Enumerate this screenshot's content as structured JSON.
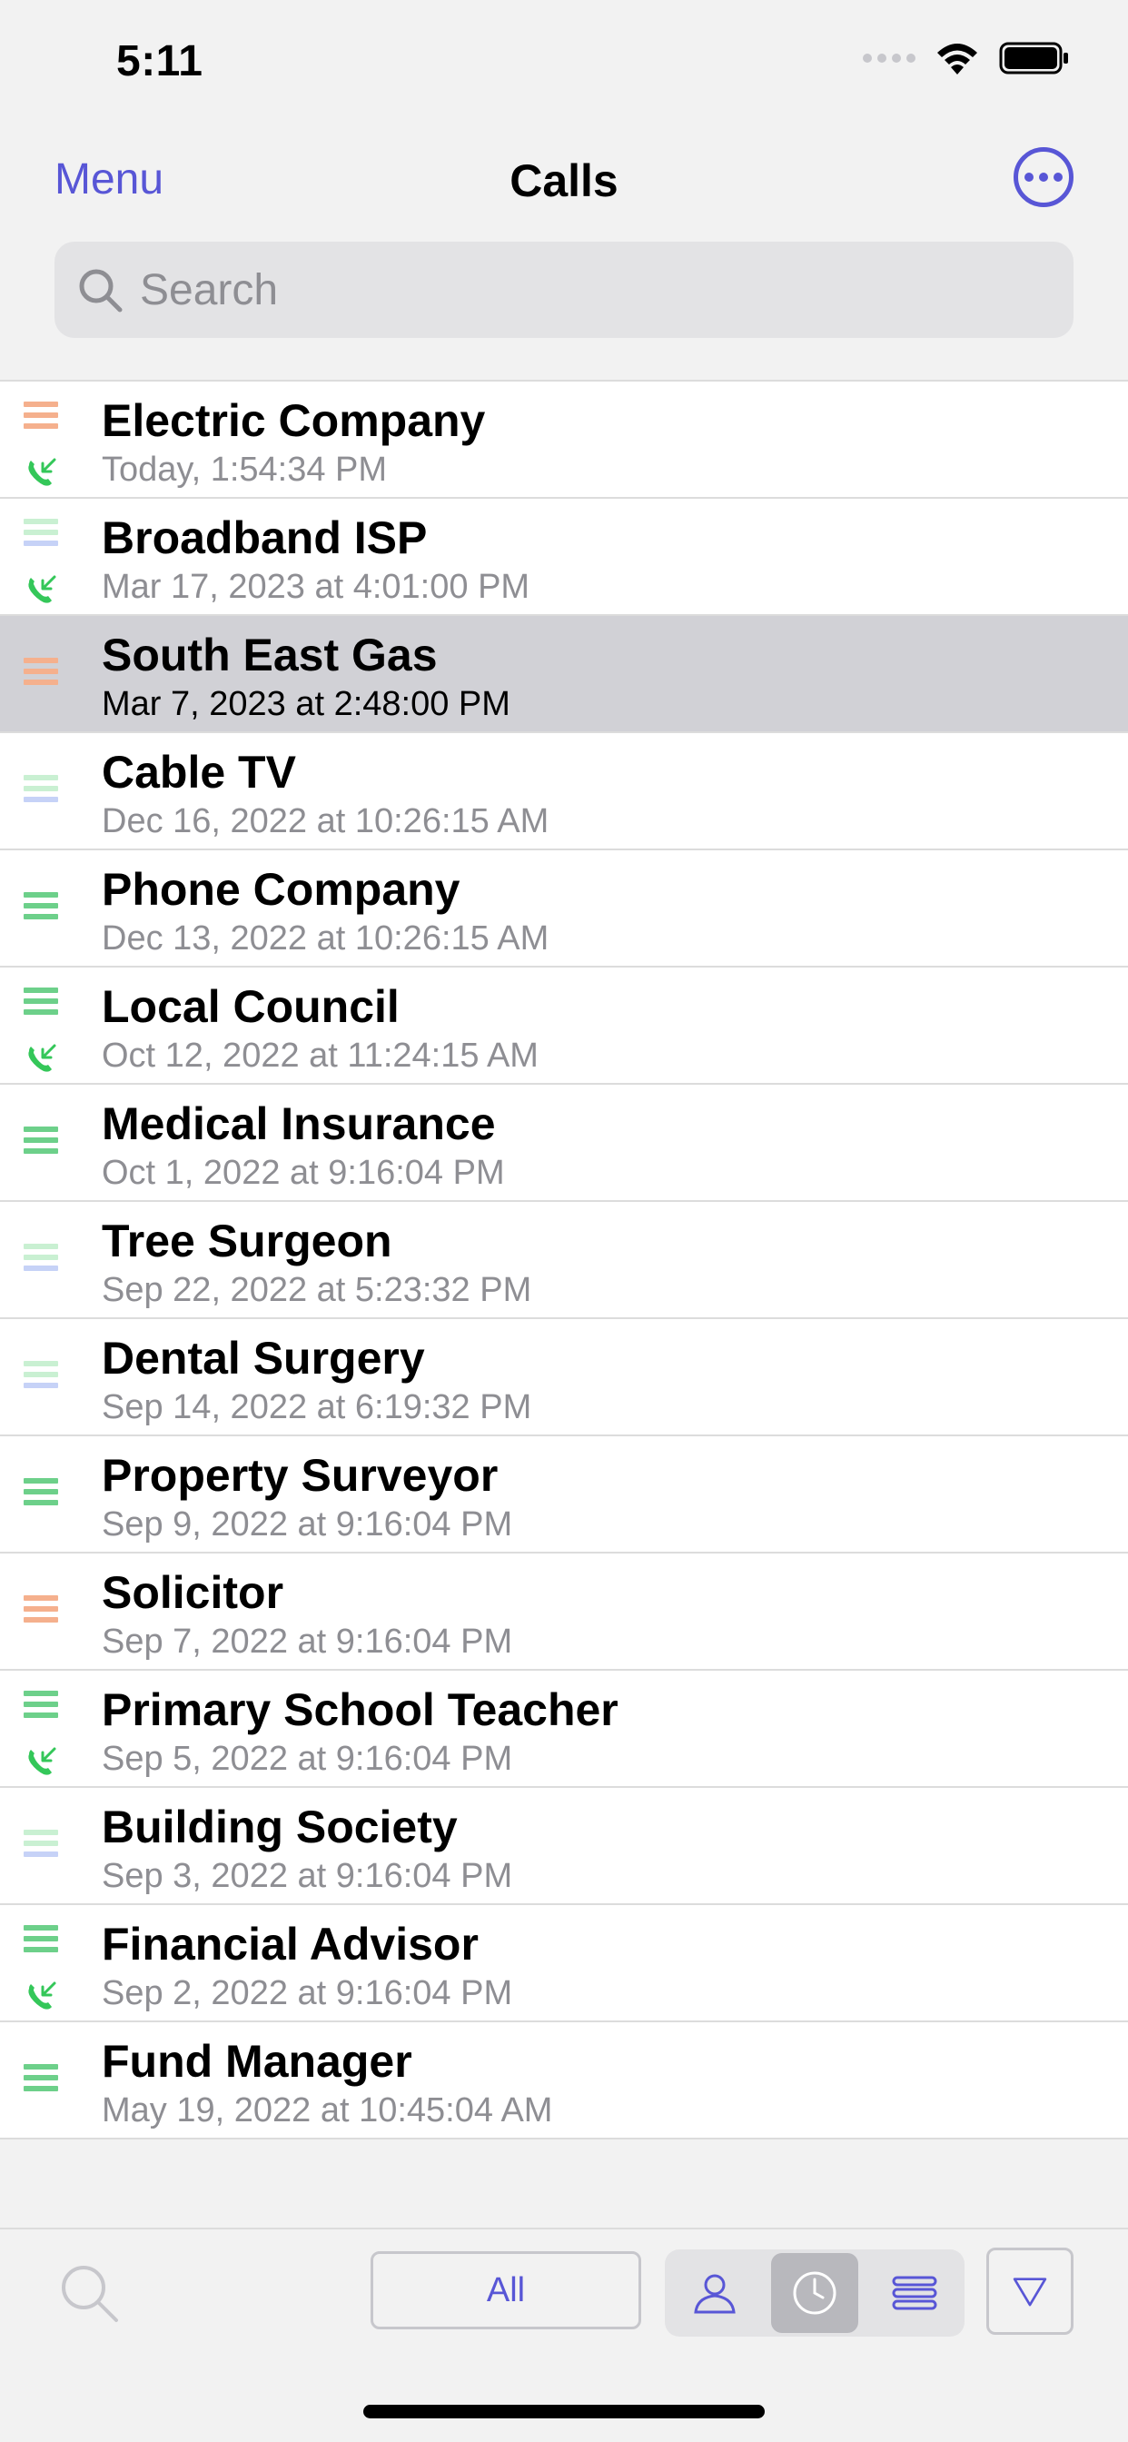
{
  "status_bar": {
    "time": "5:11"
  },
  "nav": {
    "menu_label": "Menu",
    "title": "Calls"
  },
  "search": {
    "placeholder": "Search"
  },
  "colors": {
    "accent": "#5856d6",
    "orange": "#f5b08d",
    "green": "#6dd08a",
    "green_light": "#c9f0d2",
    "blue_light": "#c6d2f7",
    "call_green": "#34c759"
  },
  "calls": [
    {
      "name": "Electric Company",
      "date": "Today, 1:54:34 PM",
      "indicator": "orange",
      "incoming": true
    },
    {
      "name": "Broadband ISP",
      "date": "Mar 17, 2023 at 4:01:00 PM",
      "indicator": "lightgreen-blue",
      "incoming": true
    },
    {
      "name": "South East Gas",
      "date": "Mar 7, 2023 at 2:48:00 PM",
      "indicator": "orange",
      "incoming": false,
      "selected": true
    },
    {
      "name": "Cable TV",
      "date": "Dec 16, 2022 at 10:26:15 AM",
      "indicator": "lightgreen-blue",
      "incoming": false
    },
    {
      "name": "Phone Company",
      "date": "Dec 13, 2022 at 10:26:15 AM",
      "indicator": "green",
      "incoming": false
    },
    {
      "name": "Local Council",
      "date": "Oct 12, 2022 at 11:24:15 AM",
      "indicator": "green",
      "incoming": true
    },
    {
      "name": "Medical Insurance",
      "date": "Oct 1, 2022 at 9:16:04 PM",
      "indicator": "green",
      "incoming": false
    },
    {
      "name": "Tree Surgeon",
      "date": "Sep 22, 2022 at 5:23:32 PM",
      "indicator": "lightgreen-blue",
      "incoming": false
    },
    {
      "name": "Dental Surgery",
      "date": "Sep 14, 2022 at 6:19:32 PM",
      "indicator": "lightgreen-blue",
      "incoming": false
    },
    {
      "name": "Property Surveyor",
      "date": "Sep 9, 2022 at 9:16:04 PM",
      "indicator": "green",
      "incoming": false
    },
    {
      "name": "Solicitor",
      "date": "Sep 7, 2022 at 9:16:04 PM",
      "indicator": "orange",
      "incoming": false
    },
    {
      "name": "Primary School Teacher",
      "date": "Sep 5, 2022 at 9:16:04 PM",
      "indicator": "green",
      "incoming": true
    },
    {
      "name": "Building Society",
      "date": "Sep 3, 2022 at 9:16:04 PM",
      "indicator": "lightgreen-blue",
      "incoming": false
    },
    {
      "name": "Financial Advisor",
      "date": "Sep 2, 2022 at 9:16:04 PM",
      "indicator": "green",
      "incoming": true
    },
    {
      "name": "Fund Manager",
      "date": "May 19, 2022 at 10:45:04 AM",
      "indicator": "green",
      "incoming": false
    }
  ],
  "toolbar": {
    "all_label": "All",
    "segments": [
      {
        "icon": "person-icon",
        "active": false
      },
      {
        "icon": "clock-icon",
        "active": true
      },
      {
        "icon": "list-icon",
        "active": false
      }
    ]
  }
}
